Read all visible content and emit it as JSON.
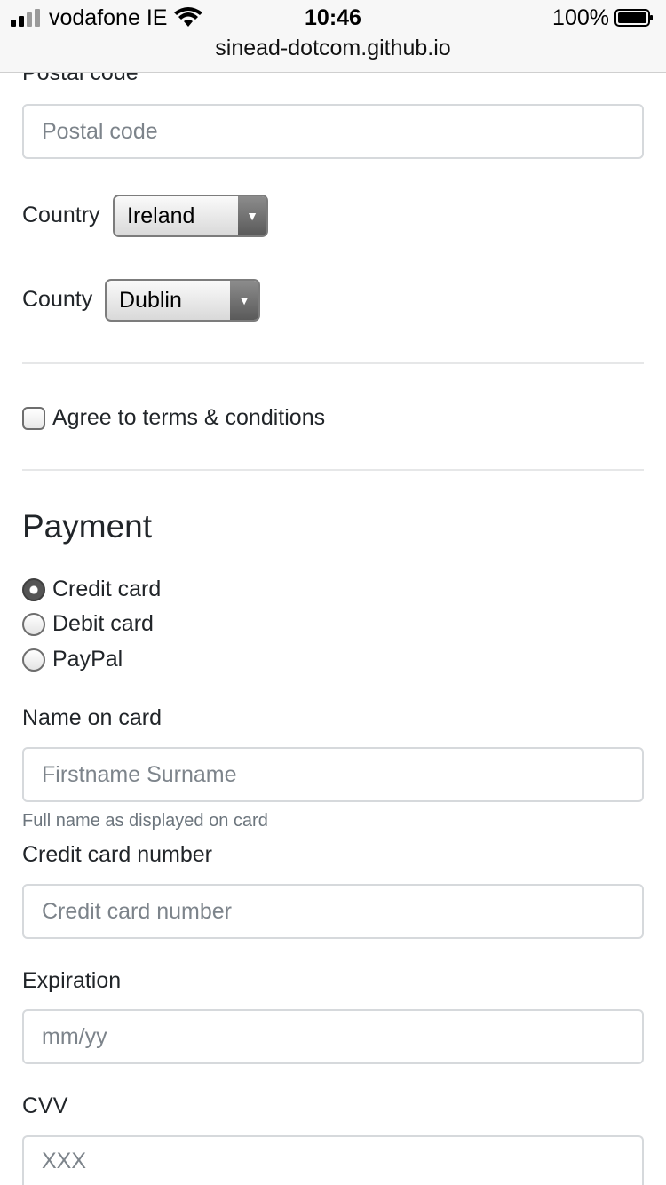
{
  "status_bar": {
    "carrier": "vodafone IE",
    "time": "10:46",
    "battery": "100%"
  },
  "browser": {
    "url": "sinead-dotcom.github.io"
  },
  "address": {
    "postal_label": "Postal code",
    "postal_placeholder": "Postal code",
    "country_label": "Country",
    "country_value": "Ireland",
    "county_label": "County",
    "county_value": "Dublin",
    "terms_label": "Agree to terms & conditions"
  },
  "payment": {
    "title": "Payment",
    "methods": [
      {
        "label": "Credit card",
        "checked": true
      },
      {
        "label": "Debit card",
        "checked": false
      },
      {
        "label": "PayPal",
        "checked": false
      }
    ],
    "name_label": "Name on card",
    "name_placeholder": "Firstname Surname",
    "name_help": "Full name as displayed on card",
    "number_label": "Credit card number",
    "number_placeholder": "Credit card number",
    "expiration_label": "Expiration",
    "expiration_placeholder": "mm/yy",
    "cvv_label": "CVV",
    "cvv_placeholder": "XXX"
  }
}
